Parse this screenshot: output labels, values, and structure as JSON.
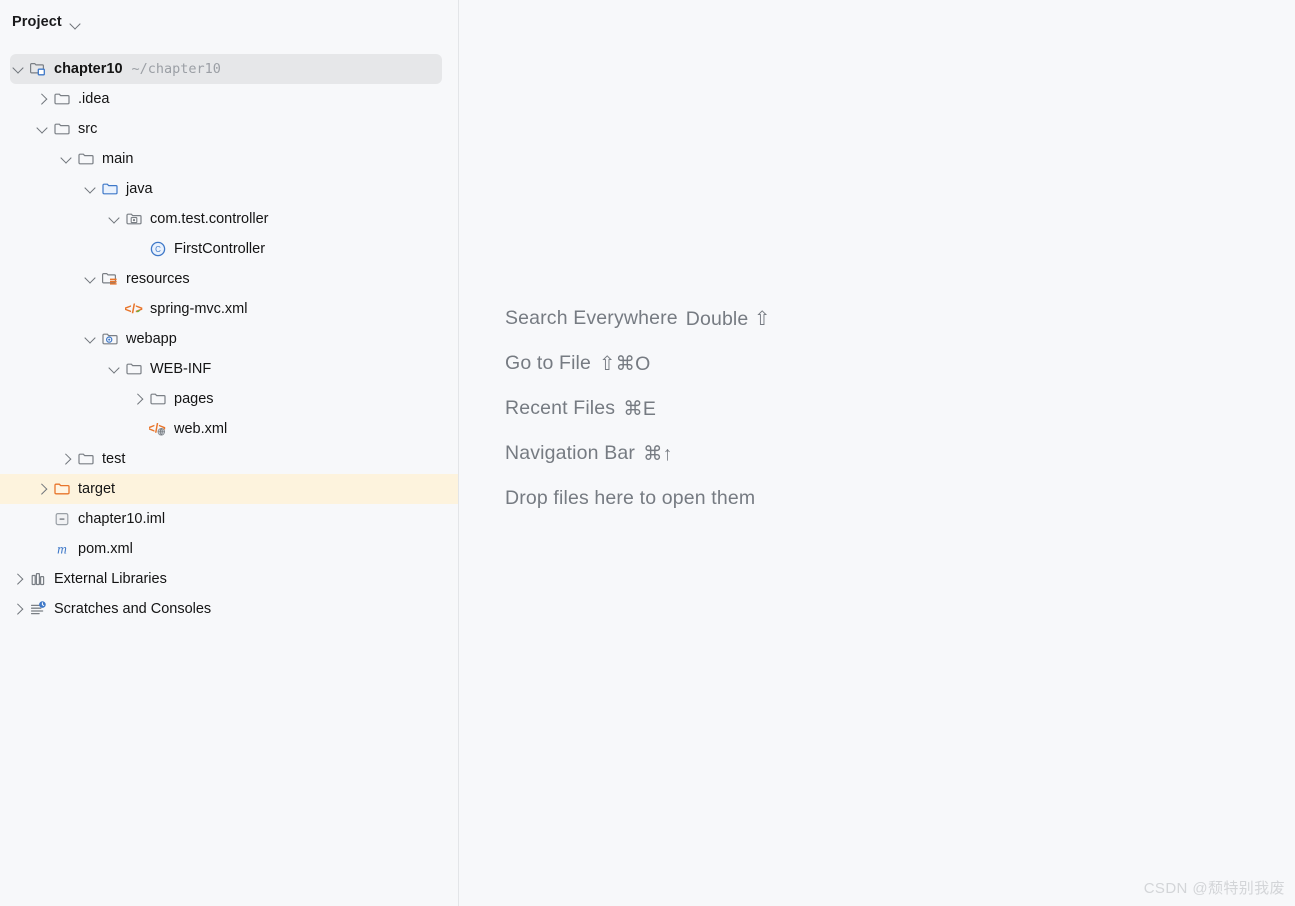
{
  "sidebar": {
    "header": {
      "title": "Project",
      "chevron_icon": "chevron-down-icon"
    },
    "tree": [
      {
        "label": "chapter10",
        "sub_label": "~/chapter10",
        "icon": "module-folder-icon",
        "twisty": "down",
        "indent": 0,
        "bold": true,
        "state": "selected-gray"
      },
      {
        "label": ".idea",
        "sub_label": "",
        "icon": "folder-icon",
        "twisty": "right",
        "indent": 1,
        "bold": false,
        "state": ""
      },
      {
        "label": "src",
        "sub_label": "",
        "icon": "folder-icon",
        "twisty": "down",
        "indent": 1,
        "bold": false,
        "state": ""
      },
      {
        "label": "main",
        "sub_label": "",
        "icon": "folder-icon",
        "twisty": "down",
        "indent": 2,
        "bold": false,
        "state": ""
      },
      {
        "label": "java",
        "sub_label": "",
        "icon": "source-folder-icon",
        "twisty": "down",
        "indent": 3,
        "bold": false,
        "state": ""
      },
      {
        "label": "com.test.controller",
        "sub_label": "",
        "icon": "package-icon",
        "twisty": "down",
        "indent": 4,
        "bold": false,
        "state": ""
      },
      {
        "label": "FirstController",
        "sub_label": "",
        "icon": "java-class-icon",
        "twisty": "none",
        "indent": 5,
        "bold": false,
        "state": ""
      },
      {
        "label": "resources",
        "sub_label": "",
        "icon": "resources-folder-icon",
        "twisty": "down",
        "indent": 3,
        "bold": false,
        "state": ""
      },
      {
        "label": "spring-mvc.xml",
        "sub_label": "",
        "icon": "spring-xml-icon",
        "twisty": "none",
        "indent": 4,
        "bold": false,
        "state": ""
      },
      {
        "label": "webapp",
        "sub_label": "",
        "icon": "webapp-folder-icon",
        "twisty": "down",
        "indent": 3,
        "bold": false,
        "state": ""
      },
      {
        "label": "WEB-INF",
        "sub_label": "",
        "icon": "folder-icon",
        "twisty": "down",
        "indent": 4,
        "bold": false,
        "state": ""
      },
      {
        "label": "pages",
        "sub_label": "",
        "icon": "folder-icon",
        "twisty": "right",
        "indent": 5,
        "bold": false,
        "state": ""
      },
      {
        "label": "web.xml",
        "sub_label": "",
        "icon": "web-xml-icon",
        "twisty": "none",
        "indent": 5,
        "bold": false,
        "state": ""
      },
      {
        "label": "test",
        "sub_label": "",
        "icon": "folder-icon",
        "twisty": "right",
        "indent": 2,
        "bold": false,
        "state": ""
      },
      {
        "label": "target",
        "sub_label": "",
        "icon": "excluded-folder-icon",
        "twisty": "right",
        "indent": 1,
        "bold": false,
        "state": "selected-amber"
      },
      {
        "label": "chapter10.iml",
        "sub_label": "",
        "icon": "iml-file-icon",
        "twisty": "none",
        "indent": 1,
        "bold": false,
        "state": ""
      },
      {
        "label": "pom.xml",
        "sub_label": "",
        "icon": "maven-pom-icon",
        "twisty": "none",
        "indent": 1,
        "bold": false,
        "state": ""
      },
      {
        "label": "External Libraries",
        "sub_label": "",
        "icon": "library-icon",
        "twisty": "right",
        "indent": 0,
        "bold": false,
        "state": ""
      },
      {
        "label": "Scratches and Consoles",
        "sub_label": "",
        "icon": "scratches-icon",
        "twisty": "right",
        "indent": 0,
        "bold": false,
        "state": ""
      }
    ]
  },
  "editor": {
    "hints": [
      {
        "action": "Search Everywhere",
        "shortcut": "Double ⇧"
      },
      {
        "action": "Go to File",
        "shortcut": "⇧⌘O"
      },
      {
        "action": "Recent Files",
        "shortcut": "⌘E"
      },
      {
        "action": "Navigation Bar",
        "shortcut": "⌘↑"
      },
      {
        "action": "Drop files here to open them",
        "shortcut": ""
      }
    ],
    "watermark": "CSDN @颓特别我废"
  },
  "colors": {
    "background": "#F7F8FA",
    "selection_gray": "#E6E7E9",
    "selection_amber": "#FDF3DD",
    "accent_blue": "#3E78C8",
    "accent_orange": "#E8752B",
    "divider": "#E3E5E8",
    "hint_text": "#767B82"
  }
}
